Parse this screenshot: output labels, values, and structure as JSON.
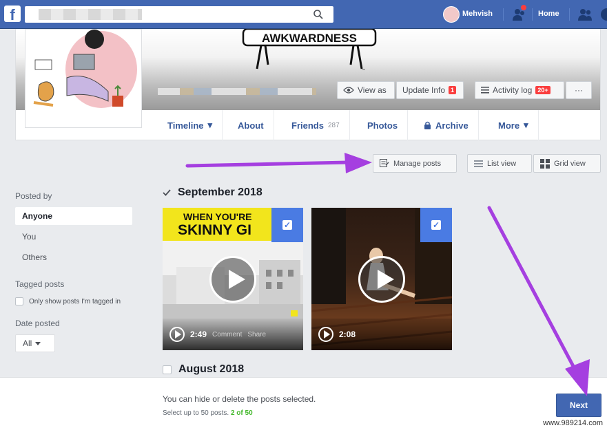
{
  "topbar": {
    "logo": "f",
    "user_name": "Mehvish",
    "home_label": "Home"
  },
  "cover": {
    "art_text": "AWKWARDNESS",
    "view_as_label": "View as",
    "update_info_label": "Update Info",
    "update_info_badge": "1",
    "activity_log_label": "Activity log",
    "activity_log_badge": "20+",
    "more_label": "···"
  },
  "nav": {
    "items": [
      {
        "label": "Timeline",
        "suffix": "▾"
      },
      {
        "label": "About"
      },
      {
        "label": "Friends",
        "count": "287"
      },
      {
        "label": "Photos"
      },
      {
        "label": "Archive"
      },
      {
        "label": "More",
        "suffix": "▾"
      }
    ]
  },
  "toolbar": {
    "manage_posts": "Manage posts",
    "list_view": "List view",
    "grid_view": "Grid view"
  },
  "sidebar": {
    "posted_by_heading": "Posted by",
    "posted_by_options": [
      "Anyone",
      "You",
      "Others"
    ],
    "selected_option": "Anyone",
    "tagged_heading": "Tagged posts",
    "tagged_checkbox_label": "Only show posts I'm tagged in",
    "date_heading": "Date posted",
    "date_value": "All"
  },
  "sections": [
    {
      "title": "September 2018",
      "checked": true
    },
    {
      "title": "August 2018",
      "checked": false
    }
  ],
  "videos": [
    {
      "overlay_line1": "WHEN YOU'RE",
      "overlay_line2": "SKINNY GI",
      "duration": "2:49",
      "comment": "Comment",
      "share": "Share",
      "selected": true
    },
    {
      "duration": "2:08",
      "selected": true
    }
  ],
  "bottom": {
    "text": "You can hide or delete the posts selected.",
    "limit_text": "Select up to 50 posts.",
    "count_text": "2 of 50",
    "next_label": "Next"
  },
  "watermark": "www.989214.com",
  "colors": {
    "brand": "#4267b2",
    "arrow": "#a53fe0",
    "selection": "#4a7be3",
    "count_green": "#42b72a"
  }
}
